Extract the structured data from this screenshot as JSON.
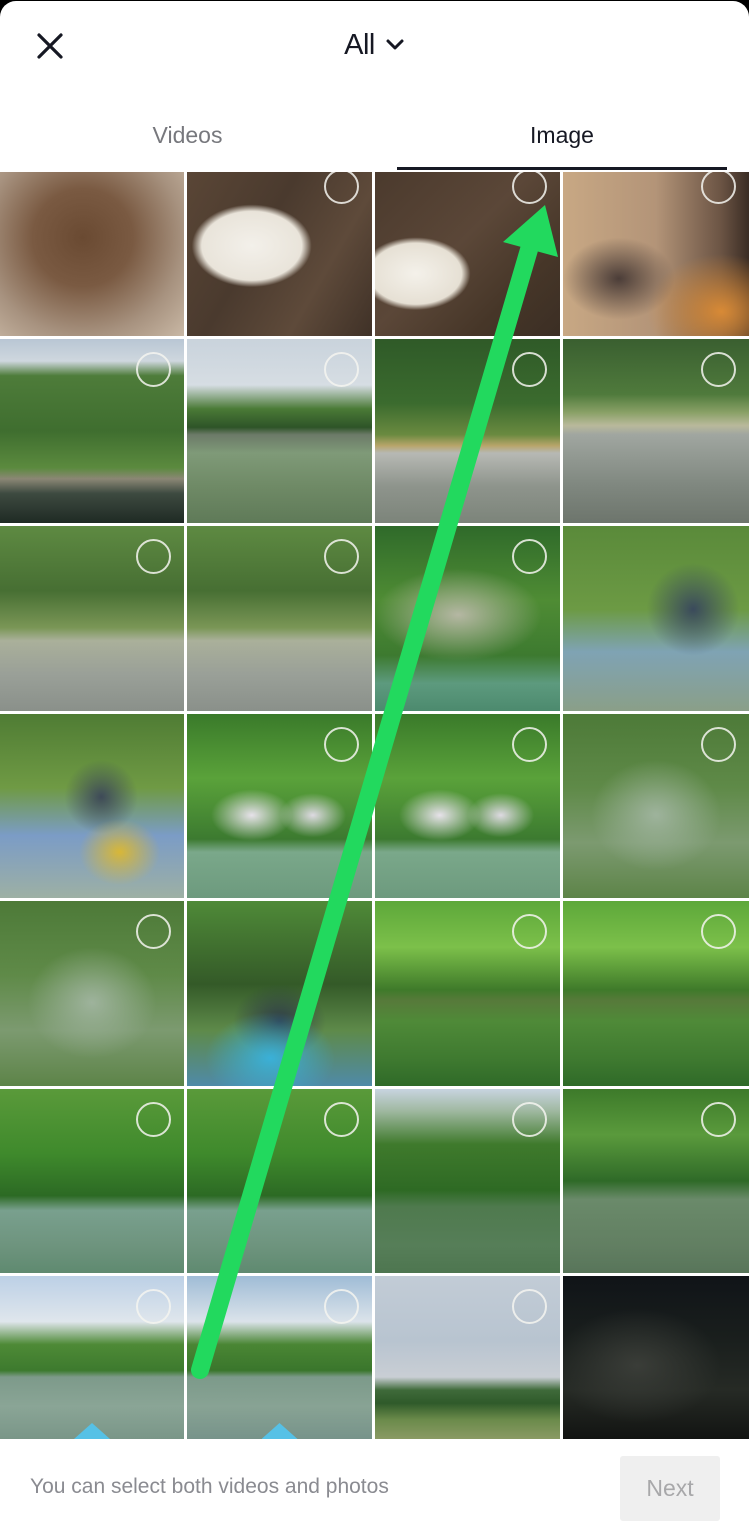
{
  "header": {
    "close_icon": "close-icon",
    "album_label": "All",
    "album_dropdown_icon": "chevron-down-icon"
  },
  "tabs": [
    {
      "label": "Videos",
      "selected": false
    },
    {
      "label": "Image",
      "selected": true
    }
  ],
  "grid": {
    "columns": 4,
    "tiles": [
      {
        "scene": "blur-brown",
        "description": "blurred photo",
        "circle": false
      },
      {
        "scene": "dog-couch",
        "description": "white dog on brown couch",
        "circle": true
      },
      {
        "scene": "dog-couch2",
        "description": "white dog on brown couch",
        "circle": true
      },
      {
        "scene": "blur-face",
        "description": "blurred photo",
        "circle": true
      },
      {
        "scene": "trees-bridge",
        "description": "trees above bridge",
        "circle": true
      },
      {
        "scene": "river-bridge",
        "description": "river with bridge",
        "circle": true
      },
      {
        "scene": "pond-grass",
        "description": "pond with grass and trees",
        "circle": true
      },
      {
        "scene": "pond-grass2",
        "description": "pond with grass and trees",
        "circle": true
      },
      {
        "scene": "pond-trees",
        "description": "pond with trees",
        "circle": true
      },
      {
        "scene": "pond-trees",
        "description": "pond with trees",
        "circle": true
      },
      {
        "scene": "cliff-green",
        "description": "green cliff above water",
        "circle": true
      },
      {
        "scene": "blur-green-blue",
        "description": "blurred photo",
        "circle": false
      },
      {
        "scene": "blur-kayak",
        "description": "blurred kayak photo",
        "circle": false
      },
      {
        "scene": "flower-kayak",
        "description": "kayaker near flowering trees",
        "circle": true
      },
      {
        "scene": "flower-kayak",
        "description": "kayaker near flowering trees",
        "circle": true
      },
      {
        "scene": "reflection",
        "description": "tree reflection in water",
        "circle": true
      },
      {
        "scene": "reflection",
        "description": "tree reflection in water",
        "circle": true
      },
      {
        "scene": "blur-blue-shirt",
        "description": "blurred photo",
        "circle": false
      },
      {
        "scene": "canopy-river",
        "description": "tree canopy over river",
        "circle": true
      },
      {
        "scene": "canopy-river",
        "description": "tree canopy over river",
        "circle": true
      },
      {
        "scene": "river-wide",
        "description": "river and trees",
        "circle": true
      },
      {
        "scene": "river-wide",
        "description": "river and trees",
        "circle": true
      },
      {
        "scene": "river-sky",
        "description": "river with trees",
        "circle": true
      },
      {
        "scene": "river-sky2",
        "description": "river with trees",
        "circle": true
      },
      {
        "scene": "kayak-sky",
        "description": "kayak bow on river",
        "circle": true,
        "kayak": true
      },
      {
        "scene": "kayak-sky2",
        "description": "kayak bow on river",
        "circle": true,
        "kayak": true
      },
      {
        "scene": "horizon",
        "description": "sky over distant hills",
        "circle": true
      },
      {
        "scene": "dark-blur",
        "description": "blurred dark photo",
        "circle": false
      }
    ]
  },
  "footer": {
    "hint": "You can select both videos and photos",
    "next_label": "Next",
    "next_enabled": false
  },
  "annotation": {
    "type": "arrow",
    "color": "#22d95e",
    "points_to": "selection circle of third thumbnail in first row"
  }
}
